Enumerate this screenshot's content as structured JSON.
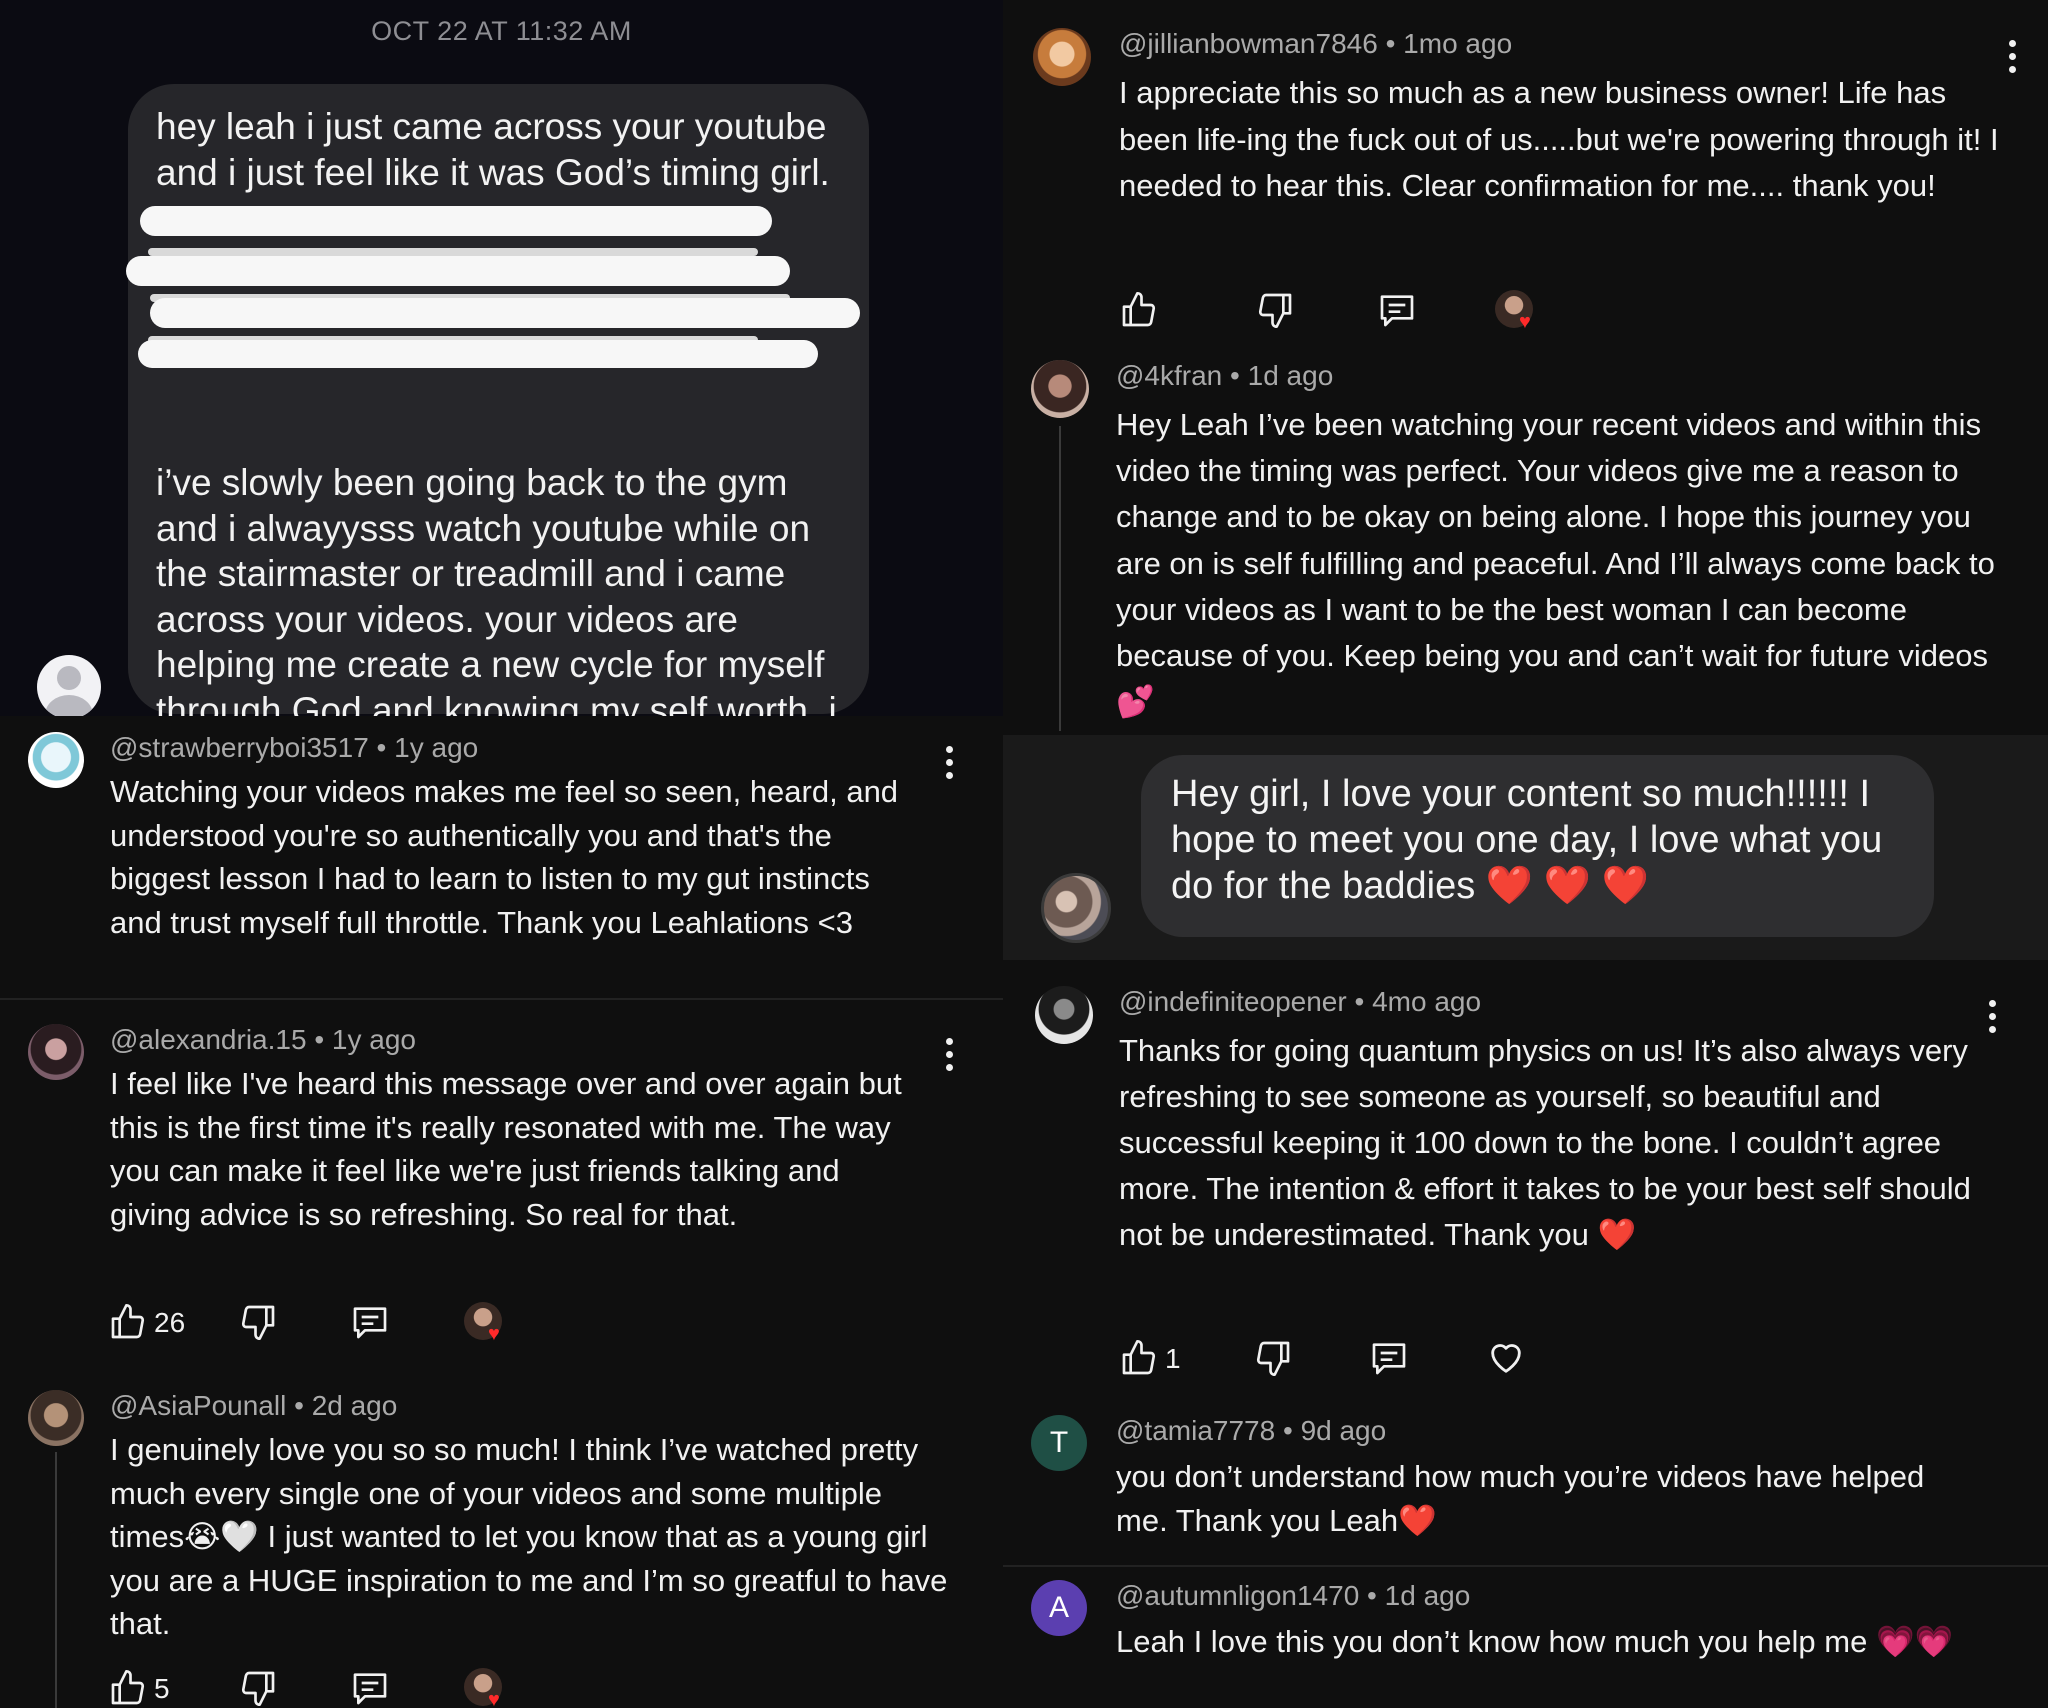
{
  "dm": {
    "timestamp": "OCT 22 AT 11:32 AM",
    "text_top": "hey leah i just came across your youtube and i just feel like it was God’s timing girl.",
    "text_bottom": "i’ve slowly been going back to the gym and i alwayysss watch youtube while on the stairmaster or treadmill and i came across your videos. your videos are helping me create a new cycle for myself through God and knowing my self worth. i thank you girl keep being you💕."
  },
  "left_comments": [
    {
      "handle": "@strawberryboi3517",
      "age": "1y ago",
      "text": "Watching your videos makes me feel so seen, heard, and understood you're so authentically you and that's the biggest lesson I had to learn to listen to my gut instincts and trust myself full throttle. Thank you Leahlations <3"
    },
    {
      "handle": "@alexandria.15",
      "age": "1y ago",
      "text": "I feel like I've heard this message over and over again but this is the first time it's really resonated with me. The way you can make it feel like we're just friends talking and giving advice is so   refreshing. So real for that.",
      "likes": "26"
    },
    {
      "handle": "@AsiaPounall",
      "age": "2d ago",
      "text": "I genuinely love you so so much! I think I’ve watched pretty much every single one of your videos and some multiple times😭🤍 I just wanted to let you know that as a young girl you are a HUGE inspiration to me and I’m so greatful to have that.",
      "likes": "5"
    }
  ],
  "right_comments": [
    {
      "handle": "@jillianbowman7846",
      "age": "1mo ago",
      "text": "I appreciate this so much as a new business owner! Life has been life-ing the fuck out of us.....but we're powering through it! I needed to hear this. Clear confirmation for me.... thank you!"
    },
    {
      "handle": "@4kfran",
      "age": "1d ago",
      "text": "Hey Leah I’ve been watching your recent videos and within this video the timing was perfect. Your videos give me a reason to change and to be okay on being alone. I hope this journey you are on is self fulfilling and peaceful. And I’ll always come back to your videos as I want to be the best woman I can become because of you. Keep being you and can’t wait for future videos 💕"
    },
    {
      "handle": "@indefiniteopener",
      "age": "4mo ago",
      "text": "Thanks for going quantum physics on us! It’s also always very refreshing to see someone as yourself, so beautiful and successful keeping it 100 down to the bone. I couldn’t agree more. The intention & effort it takes to be your best self should not be underestimated. Thank you ❤️",
      "likes": "1"
    },
    {
      "handle": "@tamia7778",
      "age": "9d ago",
      "text": "you don’t understand how much you’re videos have helped me. Thank you Leah❤️",
      "initial": "T"
    },
    {
      "handle": "@autumnligon1470",
      "age": "1d ago",
      "text": "Leah I love this you don’t know how much you help me 💗💗",
      "initial": "A"
    }
  ],
  "story_reply": {
    "text": "Hey girl, I love your content so much!!!!!! I hope to meet you one day, I love what you do for the baddies ❤️ ❤️ ❤️"
  },
  "colors": {
    "background": "#0f0f0f",
    "bubble": "#26262a",
    "meta_text": "#aaaaaa",
    "avatar_T": "#1f4f45",
    "avatar_A": "#5b3fb0",
    "heart_red": "#ff2a2a"
  },
  "icons": [
    "like-icon",
    "dislike-icon",
    "reply-icon",
    "creator-heart-icon",
    "heart-icon",
    "more-options-icon"
  ]
}
